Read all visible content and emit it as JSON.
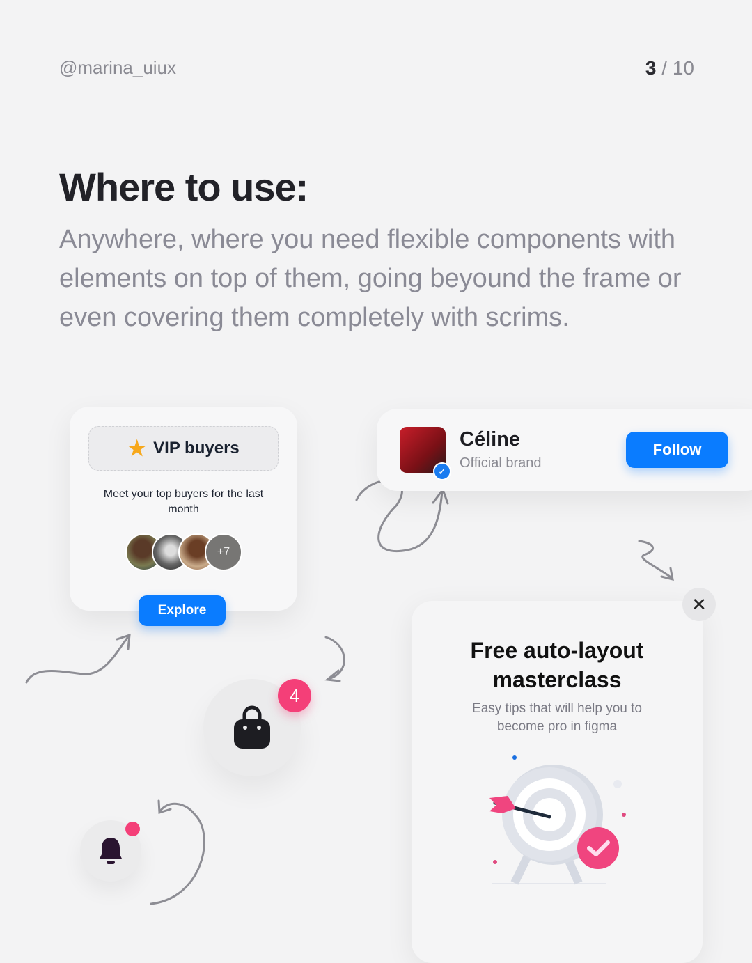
{
  "header": {
    "handle": "@marina_uiux",
    "page_current": "3",
    "page_sep": "/",
    "page_total": "10"
  },
  "heading": {
    "title": "Where to use:",
    "description": "Anywhere, where you need flexible components with elements on top of them, going beyound the frame or even covering them completely with scrims."
  },
  "vip_card": {
    "title": "VIP buyers",
    "description": "Meet your top buyers for the last month",
    "more_count": "+7",
    "button": "Explore"
  },
  "brand_card": {
    "name": "Céline",
    "subtitle": "Official brand",
    "button": "Follow"
  },
  "bag": {
    "badge": "4"
  },
  "masterclass_card": {
    "title": "Free auto-layout masterclass",
    "subtitle": "Easy tips that will help you to become pro in figma",
    "close": "✕"
  },
  "colors": {
    "accent": "#0a7cff",
    "badge": "#f43f78",
    "background": "#f3f3f4"
  }
}
